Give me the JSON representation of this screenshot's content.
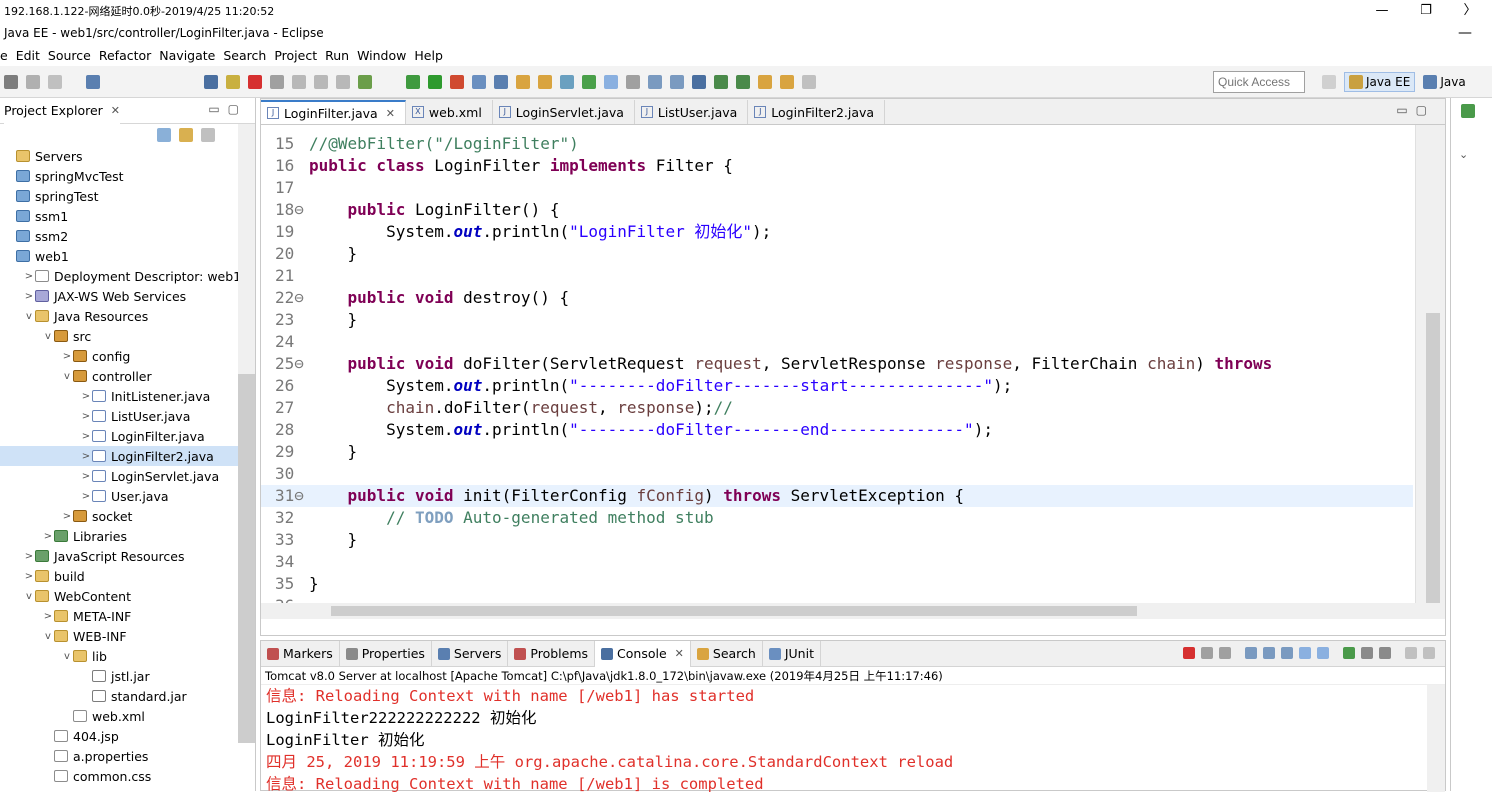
{
  "remote_bar": {
    "text": "192.168.1.122-网络延时0.0秒-2019/4/25 11:20:52",
    "controls": [
      "—",
      "❐",
      "〉"
    ]
  },
  "window": {
    "title": "Java EE - web1/src/controller/LoginFilter.java - Eclipse",
    "minimize": "—"
  },
  "menu": [
    "e",
    "Edit",
    "Source",
    "Refactor",
    "Navigate",
    "Search",
    "Project",
    "Run",
    "Window",
    "Help"
  ],
  "toolbar": {
    "quick_access_placeholder": "Quick Access",
    "perspectives": [
      "Java EE",
      "Java"
    ]
  },
  "project_explorer": {
    "title": "Project Explorer",
    "close": "✕",
    "items": [
      {
        "label": "Servers",
        "depth": 0,
        "arrow": "",
        "icon": "folder"
      },
      {
        "label": "springMvcTest",
        "depth": 0,
        "arrow": "",
        "icon": "proj"
      },
      {
        "label": "springTest",
        "depth": 0,
        "arrow": "",
        "icon": "proj"
      },
      {
        "label": "ssm1",
        "depth": 0,
        "arrow": "",
        "icon": "proj"
      },
      {
        "label": "ssm2",
        "depth": 0,
        "arrow": "",
        "icon": "proj"
      },
      {
        "label": "web1",
        "depth": 0,
        "arrow": "",
        "icon": "proj"
      },
      {
        "label": "Deployment Descriptor: web1",
        "depth": 1,
        "arrow": ">",
        "icon": "file"
      },
      {
        "label": "JAX-WS Web Services",
        "depth": 1,
        "arrow": ">",
        "icon": "ws"
      },
      {
        "label": "Java Resources",
        "depth": 1,
        "arrow": "v",
        "icon": "folder"
      },
      {
        "label": "src",
        "depth": 2,
        "arrow": "v",
        "icon": "pkg"
      },
      {
        "label": "config",
        "depth": 3,
        "arrow": ">",
        "icon": "pkg"
      },
      {
        "label": "controller",
        "depth": 3,
        "arrow": "v",
        "icon": "pkg"
      },
      {
        "label": "InitListener.java",
        "depth": 4,
        "arrow": ">",
        "icon": "java"
      },
      {
        "label": "ListUser.java",
        "depth": 4,
        "arrow": ">",
        "icon": "java"
      },
      {
        "label": "LoginFilter.java",
        "depth": 4,
        "arrow": ">",
        "icon": "java"
      },
      {
        "label": "LoginFilter2.java",
        "depth": 4,
        "arrow": ">",
        "icon": "java",
        "selected": true
      },
      {
        "label": "LoginServlet.java",
        "depth": 4,
        "arrow": ">",
        "icon": "java"
      },
      {
        "label": "User.java",
        "depth": 4,
        "arrow": ">",
        "icon": "java"
      },
      {
        "label": "socket",
        "depth": 3,
        "arrow": ">",
        "icon": "pkg"
      },
      {
        "label": "Libraries",
        "depth": 2,
        "arrow": ">",
        "icon": "lib"
      },
      {
        "label": "JavaScript Resources",
        "depth": 1,
        "arrow": ">",
        "icon": "lib"
      },
      {
        "label": "build",
        "depth": 1,
        "arrow": ">",
        "icon": "folder"
      },
      {
        "label": "WebContent",
        "depth": 1,
        "arrow": "v",
        "icon": "folder"
      },
      {
        "label": "META-INF",
        "depth": 2,
        "arrow": ">",
        "icon": "folder"
      },
      {
        "label": "WEB-INF",
        "depth": 2,
        "arrow": "v",
        "icon": "folder"
      },
      {
        "label": "lib",
        "depth": 3,
        "arrow": "v",
        "icon": "folder"
      },
      {
        "label": "jstl.jar",
        "depth": 4,
        "arrow": "",
        "icon": "jar"
      },
      {
        "label": "standard.jar",
        "depth": 4,
        "arrow": "",
        "icon": "jar"
      },
      {
        "label": "web.xml",
        "depth": 3,
        "arrow": "",
        "icon": "file"
      },
      {
        "label": "404.jsp",
        "depth": 2,
        "arrow": "",
        "icon": "file"
      },
      {
        "label": "a.properties",
        "depth": 2,
        "arrow": "",
        "icon": "file"
      },
      {
        "label": "common.css",
        "depth": 2,
        "arrow": "",
        "icon": "file"
      }
    ]
  },
  "editor": {
    "tabs": [
      {
        "label": "LoginFilter.java",
        "icon": "J",
        "active": true,
        "close": "✕"
      },
      {
        "label": "web.xml",
        "icon": "X",
        "active": false
      },
      {
        "label": "LoginServlet.java",
        "icon": "J",
        "active": false
      },
      {
        "label": "ListUser.java",
        "icon": "J",
        "active": false
      },
      {
        "label": "LoginFilter2.java",
        "icon": "J",
        "active": false
      }
    ],
    "lines": [
      {
        "n": "15",
        "segs": [
          [
            "cm",
            "//@WebFilter(\"/LoginFilter\")"
          ]
        ]
      },
      {
        "n": "16",
        "segs": [
          [
            "kw",
            "public class "
          ],
          [
            "",
            "LoginFilter "
          ],
          [
            "kw",
            "implements "
          ],
          [
            "",
            "Filter {"
          ]
        ]
      },
      {
        "n": "17",
        "segs": []
      },
      {
        "n": "18⊖",
        "segs": [
          [
            "",
            "    "
          ],
          [
            "kw",
            "public "
          ],
          [
            "",
            "LoginFilter() {"
          ]
        ]
      },
      {
        "n": "19",
        "segs": [
          [
            "",
            "        System."
          ],
          [
            "fld",
            "out"
          ],
          [
            "",
            ".println("
          ],
          [
            "st",
            "\"LoginFilter 初始化\""
          ],
          [
            "",
            ");"
          ]
        ]
      },
      {
        "n": "20",
        "segs": [
          [
            "",
            "    }"
          ]
        ]
      },
      {
        "n": "21",
        "segs": []
      },
      {
        "n": "22⊖",
        "segs": [
          [
            "",
            "    "
          ],
          [
            "kw",
            "public void "
          ],
          [
            "",
            "destroy() {"
          ]
        ]
      },
      {
        "n": "23",
        "segs": [
          [
            "",
            "    }"
          ]
        ]
      },
      {
        "n": "24",
        "segs": []
      },
      {
        "n": "25⊖",
        "segs": [
          [
            "",
            "    "
          ],
          [
            "kw",
            "public void "
          ],
          [
            "",
            "doFilter(ServletRequest "
          ],
          [
            "par",
            "request"
          ],
          [
            "",
            ", ServletResponse "
          ],
          [
            "par",
            "response"
          ],
          [
            "",
            ", FilterChain "
          ],
          [
            "par",
            "chain"
          ],
          [
            "",
            ") "
          ],
          [
            "kw",
            "throws"
          ]
        ]
      },
      {
        "n": "26",
        "segs": [
          [
            "",
            "        System."
          ],
          [
            "fld",
            "out"
          ],
          [
            "",
            ".println("
          ],
          [
            "st",
            "\"--------doFilter-------start--------------\""
          ],
          [
            "",
            ");"
          ]
        ]
      },
      {
        "n": "27",
        "segs": [
          [
            "",
            "        "
          ],
          [
            "par",
            "chain"
          ],
          [
            "",
            ".doFilter("
          ],
          [
            "par",
            "request"
          ],
          [
            "",
            ", "
          ],
          [
            "par",
            "response"
          ],
          [
            "",
            ");"
          ],
          [
            "cm",
            "//"
          ]
        ]
      },
      {
        "n": "28",
        "segs": [
          [
            "",
            "        System."
          ],
          [
            "fld",
            "out"
          ],
          [
            "",
            ".println("
          ],
          [
            "st",
            "\"--------doFilter-------end--------------\""
          ],
          [
            "",
            ");"
          ]
        ]
      },
      {
        "n": "29",
        "segs": [
          [
            "",
            "    }"
          ]
        ]
      },
      {
        "n": "30",
        "segs": []
      },
      {
        "n": "31⊖",
        "segs": [
          [
            "",
            "    "
          ],
          [
            "kw",
            "public void "
          ],
          [
            "",
            "init(FilterConfig "
          ],
          [
            "par",
            "fConfig"
          ],
          [
            "",
            ") "
          ],
          [
            "kw",
            "throws "
          ],
          [
            "",
            "ServletException {"
          ]
        ],
        "highlight": true
      },
      {
        "n": "32",
        "segs": [
          [
            "",
            "        "
          ],
          [
            "cm",
            "// "
          ],
          [
            "td",
            "TODO"
          ],
          [
            "cm",
            " Auto-generated method stub"
          ]
        ]
      },
      {
        "n": "33",
        "segs": [
          [
            "",
            "    }"
          ]
        ]
      },
      {
        "n": "34",
        "segs": []
      },
      {
        "n": "35",
        "segs": [
          [
            "",
            "}"
          ]
        ]
      },
      {
        "n": "36",
        "segs": []
      }
    ]
  },
  "console_view": {
    "tabs": [
      {
        "label": "Markers",
        "active": false
      },
      {
        "label": "Properties",
        "active": false
      },
      {
        "label": "Servers",
        "active": false
      },
      {
        "label": "Problems",
        "active": false
      },
      {
        "label": "Console",
        "active": true,
        "close": "✕"
      },
      {
        "label": "Search",
        "active": false
      },
      {
        "label": "JUnit",
        "active": false
      }
    ],
    "description": "Tomcat v8.0 Server at localhost [Apache Tomcat] C:\\pf\\Java\\jdk1.8.0_172\\bin\\javaw.exe (2019年4月25日 上午11:17:46)",
    "lines": [
      {
        "text": "信息: Reloading Context with name [/web1] has started",
        "err": true
      },
      {
        "text": "LoginFilter222222222222 初始化",
        "err": false
      },
      {
        "text": "LoginFilter 初始化",
        "err": false
      },
      {
        "text": "四月 25, 2019 11:19:59 上午 org.apache.catalina.core.StandardContext reload",
        "err": true
      },
      {
        "text": "信息: Reloading Context with name [/web1] is completed",
        "err": true
      }
    ]
  },
  "colors": {
    "accent": "#3a7cc9",
    "error_text": "#e0302a",
    "keyword": "#7f0055",
    "string": "#2a00ff",
    "comment": "#3f7f5f"
  }
}
